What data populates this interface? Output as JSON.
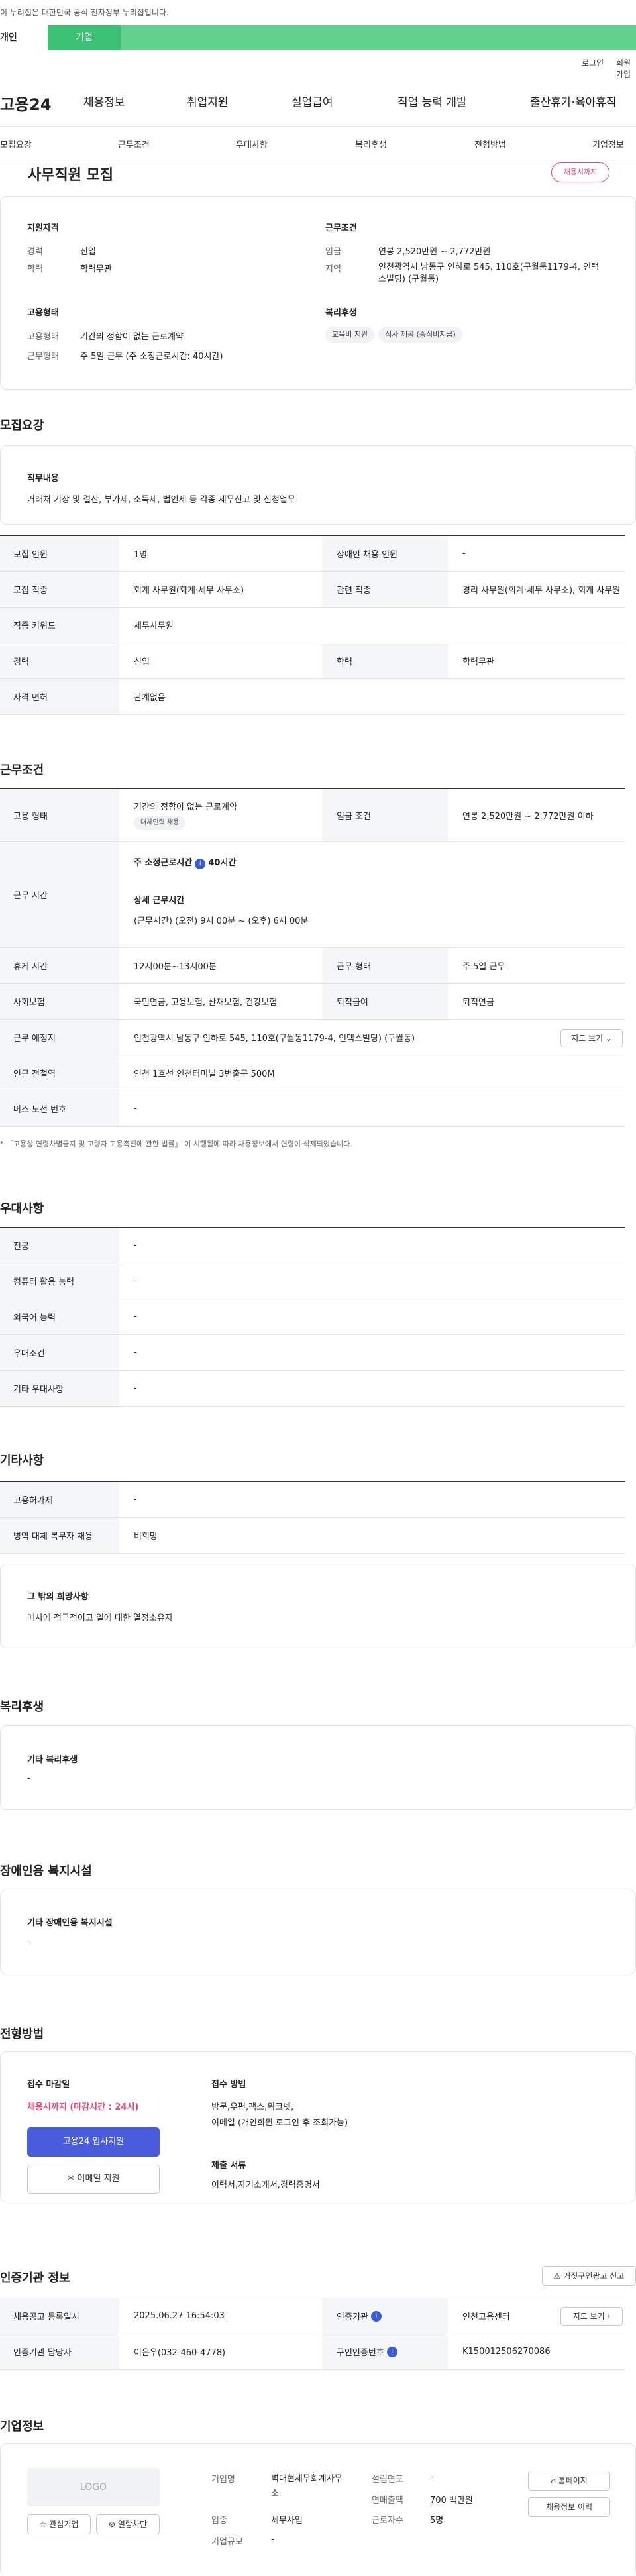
{
  "gov_banner": "이 누리집은 대한민국 공식 전자정부 누리집입니다.",
  "gov_tabs": [
    "개인",
    "기업"
  ],
  "util": [
    "로그인",
    "회원가입"
  ],
  "logo": "고용24",
  "gnb": [
    "채용정보",
    "취업지원",
    "실업급여",
    "직업 능력 개발",
    "출산휴가·육아휴직"
  ],
  "subnav": [
    "모집요강",
    "근무조건",
    "우대사항",
    "복리후생",
    "전형방법",
    "기업정보"
  ],
  "title": "사무직원 모집",
  "status_badge": "채용시까지",
  "summary": {
    "qual_title": "지원자격",
    "career_k": "경력",
    "career_v": "신입",
    "edu_k": "학력",
    "edu_v": "학력무관",
    "emp_title": "고용형태",
    "emp_k": "고용형태",
    "emp_v": "기간의 정함이 없는 근로계약",
    "hours_k": "근무형태",
    "hours_v": "주 5일 근무 (주 소정근로시간: 40시간)",
    "cond_title": "근무조건",
    "wage_k": "임금",
    "wage_v": "연봉 2,520만원 ~ 2,772만원",
    "region_k": "지역",
    "region_v": "인천광역시 남동구 인하로 545, 110호(구월동1179-4, 인택스빌딩) (구월동)",
    "welfare_title": "복리후생",
    "welfare_chips": [
      "교육비 지원",
      "식사 제공 (중식비지급)"
    ]
  },
  "recruit": {
    "section": "모집요강",
    "duty_title": "직무내용",
    "duty_text": "거래처 기장 및 결산, 부가세, 소득세, 법인세 등 각종 세무신고 및 신청업무",
    "rows": [
      {
        "k": "모집 인원",
        "v": "1명",
        "k2": "장애인 채용 인원",
        "v2": "-"
      },
      {
        "k": "모집 직종",
        "v": "회계 사무원(회계·세무 사무소)",
        "k2": "관련 직종",
        "v2": "경리 사무원(회계·세무 사무소), 회계 사무원"
      },
      {
        "k": "직종 키워드",
        "v": "세무사무원"
      },
      {
        "k": "경력",
        "v": "신입",
        "k2": "학력",
        "v2": "학력무관"
      },
      {
        "k": "자격 면허",
        "v": "관계없음"
      }
    ]
  },
  "work": {
    "section": "근무조건",
    "emp_k": "고용 형태",
    "emp_v": "기간의 정함이 없는 근로계약",
    "emp_chip": "대체인력 채용",
    "wage_k": "임금 조건",
    "wage_v": "연봉 2,520만원 ~ 2,772만원 이하",
    "time_k": "근무 시간",
    "time_1": "주 소정근로시간",
    "time_1b": "40시간",
    "time_2": "상세 근무시간",
    "time_2b": "(근무시간) (오전) 9시 00분 ~ (오후) 6시 00분",
    "rest_k": "휴게 시간",
    "rest_v": "12시00분~13시00분",
    "form_k": "근무 형태",
    "form_v": "주 5일 근무",
    "ins_k": "사회보험",
    "ins_v": "국민연금, 고용보험, 산재보험, 건강보험",
    "ret_k": "퇴직급여",
    "ret_v": "퇴직연금",
    "addr_k": "근무 예정지",
    "addr_v": "인천광역시 남동구 인하로 545, 110호(구월동1179-4, 인택스빌딩) (구월동)",
    "map_btn": "지도 보기",
    "station_k": "인근 전철역",
    "station_v": "인천 1호선 인천터미널 3번출구 500M",
    "bus_k": "버스 노선 번호",
    "bus_v": "-",
    "note": "「고용상 연령차별금지 및 고령자 고용촉진에 관한 법률」 이 시행됨에 따라 채용정보에서 연령이 삭제되었습니다."
  },
  "pref": {
    "section": "우대사항",
    "rows": [
      {
        "k": "전공",
        "v": "-"
      },
      {
        "k": "컴퓨터 활용 능력",
        "v": "-"
      },
      {
        "k": "외국어 능력",
        "v": "-"
      },
      {
        "k": "우대조건",
        "v": "-"
      },
      {
        "k": "기타 우대사항",
        "v": "-"
      }
    ]
  },
  "etc": {
    "section": "기타사항",
    "rows": [
      {
        "k": "고용허가제",
        "v": "-"
      },
      {
        "k": "병역 대체 복무자 채용",
        "v": "비희망"
      }
    ],
    "wish_title": "그 밖의 희망사항",
    "wish_text": "매사에 적극적이고 일에 대한 열정소유자"
  },
  "welfare": {
    "section": "복리후생",
    "title": "기타 복리후생",
    "text": "-"
  },
  "disab": {
    "section": "장애인용 복지시설",
    "title": "기타 장애인용 복지시설",
    "text": "-"
  },
  "process": {
    "section": "전형방법",
    "deadline_title": "접수 마감일",
    "deadline_v": "채용시까지 (마감시간 : 24시)",
    "apply_btn": "고용24 입사지원",
    "email_btn": "이메일 지원",
    "method_title": "접수 방법",
    "method_v1": "방문,우편,팩스,워크넷,",
    "method_v2": "이메일 (개인회원 로그인 후 조회가능)",
    "docs_title": "제출 서류",
    "docs_v": "이력서,자기소개서,경력증명서"
  },
  "auth": {
    "section": "인증기관 정보",
    "report_btn": "거짓구인광고 신고",
    "reg_k": "채용공고 등록일시",
    "reg_v": "2025.06.27 16:54:03",
    "org_k": "인증기관",
    "org_v": "인천고용센터",
    "map_btn": "지도 보기",
    "mgr_k": "인증기관 담당자",
    "mgr_v": "이은우(032-460-4778)",
    "num_k": "구인인증번호",
    "num_v": "K150012506270086"
  },
  "company": {
    "section": "기업정보",
    "logo": "LOGO",
    "fav_btn": "관심기업",
    "block_btn": "열람차단",
    "name_k": "기업명",
    "name_v": "벽대현세무회계사무소",
    "ind_k": "업종",
    "ind_v": "세무사업",
    "size_k": "기업규모",
    "size_v": "-",
    "year_k": "설립연도",
    "year_v": "-",
    "sales_k": "연매출액",
    "sales_v": "700 백만원",
    "emp_k": "근로자수",
    "emp_v": "5명",
    "home_btn": "홈페이지",
    "hist_btn": "채용정보 이력"
  }
}
